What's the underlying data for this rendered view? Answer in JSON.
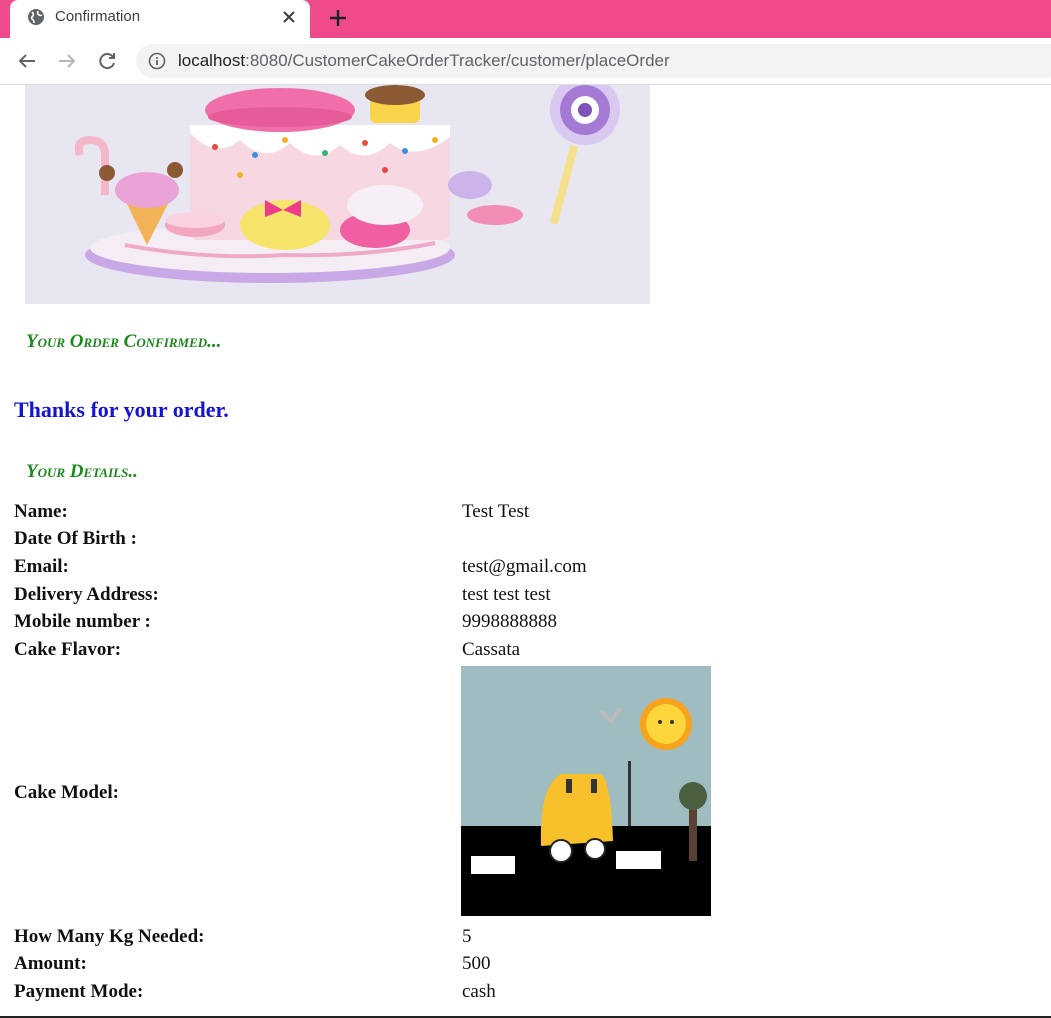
{
  "browser": {
    "tab_title": "Confirmation",
    "url_host": "localhost",
    "url_rest": ":8080/CustomerCakeOrderTracker/customer/placeOrder",
    "accent": "#ef4a8c"
  },
  "page": {
    "order_confirmed_heading": "Your Order Confirmed...",
    "thanks_message": "Thanks for your order.",
    "details_heading": "Your Details..",
    "heading_color": "#1a8a1a",
    "thanks_color": "#1414d2"
  },
  "details": {
    "name": {
      "label": "Name:",
      "value": "Test Test"
    },
    "dob": {
      "label": "Date Of Birth :",
      "value": ""
    },
    "email": {
      "label": "Email:",
      "value": "test@gmail.com"
    },
    "address": {
      "label": "Delivery Address:",
      "value": "test test test"
    },
    "mobile": {
      "label": "Mobile number :",
      "value": "9998888888"
    },
    "flavor": {
      "label": "Cake Flavor:",
      "value": "Cassata"
    },
    "model": {
      "label": "Cake Model:"
    },
    "kg": {
      "label": "How Many Kg Needed:",
      "value": "5"
    },
    "amount": {
      "label": "Amount:",
      "value": "500"
    },
    "payment": {
      "label": "Payment Mode:",
      "value": "cash"
    }
  },
  "icons": {
    "tab": "globe-icon",
    "close": "close-icon",
    "new_tab": "plus-icon",
    "back": "back-arrow-icon",
    "forward": "forward-arrow-icon",
    "reload": "reload-icon",
    "info": "info-icon"
  }
}
